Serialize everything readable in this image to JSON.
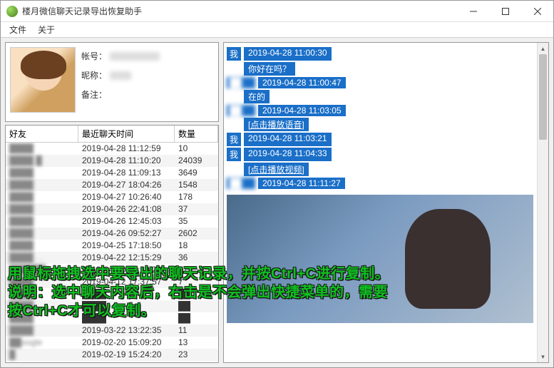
{
  "window": {
    "title": "楼月微信聊天记录导出恢复助手"
  },
  "menu": {
    "file": "文件",
    "about": "关于"
  },
  "profile": {
    "account_label": "帐号：",
    "nickname_label": "昵称：",
    "remark_label": "备注："
  },
  "friends": {
    "headers": {
      "name": "好友",
      "time": "最近聊天时间",
      "count": "数量"
    },
    "rows": [
      {
        "name": "████",
        "time": "2019-04-28 11:12:59",
        "count": "10"
      },
      {
        "name": "████ █",
        "time": "2019-04-28 11:10:20",
        "count": "24039"
      },
      {
        "name": "████",
        "time": "2019-04-28 11:09:13",
        "count": "3649"
      },
      {
        "name": "████",
        "time": "2019-04-27 18:04:26",
        "count": "1548"
      },
      {
        "name": "████",
        "time": "2019-04-27 10:26:40",
        "count": "178"
      },
      {
        "name": "████",
        "time": "2019-04-26 22:41:08",
        "count": "37"
      },
      {
        "name": "████",
        "time": "2019-04-26 12:45:03",
        "count": "35"
      },
      {
        "name": "████",
        "time": "2019-04-26 09:52:27",
        "count": "2602"
      },
      {
        "name": "████",
        "time": "2019-04-25 17:18:50",
        "count": "18"
      },
      {
        "name": "████ . .",
        "time": "2019-04-22 12:15:29",
        "count": "36"
      },
      {
        "name": "██████",
        "time": "2019-04-20 09:39:23",
        "count": "27"
      },
      {
        "name": "████",
        "time": "2019-04-12 17:37:57",
        "count": "7"
      },
      {
        "name": "████",
        "time": "████",
        "count": "██"
      },
      {
        "name": "████",
        "time": "████",
        "count": "██"
      },
      {
        "name": "████",
        "time": "████",
        "count": "██"
      },
      {
        "name": "████",
        "time": "2019-03-22 13:22:35",
        "count": "11"
      },
      {
        "name": "██oogle",
        "time": "2019-02-20 15:09:20",
        "count": "13"
      },
      {
        "name": "█",
        "time": "2019-02-19 15:24:20",
        "count": "23"
      }
    ]
  },
  "chat": {
    "lines": [
      {
        "type": "header",
        "name": "我",
        "ts": "2019-04-28 11:00:30"
      },
      {
        "type": "msg",
        "text": "你好在吗？",
        "indent": true
      },
      {
        "type": "header",
        "name": "██",
        "ts": "2019-04-28 11:00:47",
        "blurred": true
      },
      {
        "type": "msg",
        "text": "在的",
        "indent": true
      },
      {
        "type": "header",
        "name": "██",
        "ts": "2019-04-28 11:03:05",
        "blurred": true
      },
      {
        "type": "msg",
        "text": "[点击播放语音]",
        "indent": true,
        "link": true
      },
      {
        "type": "header",
        "name": "我",
        "ts": "2019-04-28 11:03:21"
      },
      {
        "type": "header",
        "name": "我",
        "ts": "2019-04-28 11:04:33"
      },
      {
        "type": "msg",
        "text": "[点击播放视频]",
        "indent": true,
        "link": true
      },
      {
        "type": "header",
        "name": "██",
        "ts": "2019-04-28 11:11:27",
        "blurred": true
      },
      {
        "type": "image"
      }
    ]
  },
  "overlay": {
    "line1": "用鼠标拖拽选中要导出的聊天记录，并按Ctrl+C进行复制。",
    "line2": "说明：选中聊天内容后，右击是不会弹出快捷菜单的，需要",
    "line3": "按Ctrl+C才可以复制。"
  }
}
